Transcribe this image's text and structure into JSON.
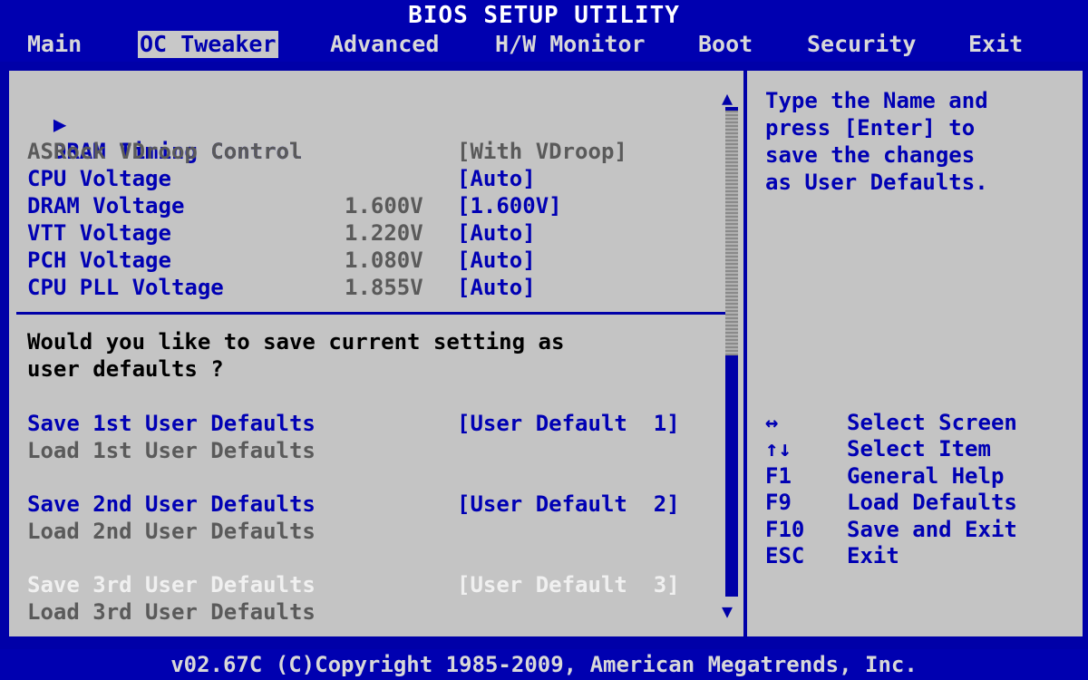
{
  "title": "BIOS SETUP UTILITY",
  "menu": [
    "Main",
    "OC Tweaker",
    "Advanced",
    "H/W Monitor",
    "Boot",
    "Security",
    "Exit"
  ],
  "submenu": {
    "arrow": "▶",
    "label": "DRAM Timing Control"
  },
  "settings": [
    {
      "label": "ASRock VDroop Control",
      "current": "",
      "value": "[With VDroop]"
    },
    {
      "label": "CPU Voltage",
      "current": "",
      "value": "[Auto]"
    },
    {
      "label": "DRAM Voltage",
      "current": "1.600V",
      "value": "[1.600V]"
    },
    {
      "label": "VTT Voltage",
      "current": "1.220V",
      "value": "[Auto]"
    },
    {
      "label": "PCH Voltage",
      "current": "1.080V",
      "value": "[Auto]"
    },
    {
      "label": "CPU PLL Voltage",
      "current": "1.855V",
      "value": "[Auto]"
    }
  ],
  "question": [
    "Would you like to save current setting as",
    "user defaults ?"
  ],
  "user_defaults": [
    {
      "label": "Save 1st User Defaults",
      "value": "[User Default  1]"
    },
    {
      "label": "Load 1st User Defaults",
      "value": ""
    },
    {
      "label": "Save 2nd User Defaults",
      "value": "[User Default  2]"
    },
    {
      "label": "Load 2nd User Defaults",
      "value": ""
    },
    {
      "label": "Save 3rd User Defaults",
      "value": "[User Default  3]"
    },
    {
      "label": "Load 3rd User Defaults",
      "value": ""
    }
  ],
  "help_text": [
    "Type the Name and",
    "press [Enter] to",
    "save the changes",
    "as User Defaults."
  ],
  "keys": [
    {
      "key": "↔",
      "action": "Select Screen"
    },
    {
      "key": "↑↓",
      "action": "Select Item"
    },
    {
      "key": "F1",
      "action": "General Help"
    },
    {
      "key": "F9",
      "action": "Load Defaults"
    },
    {
      "key": "F10",
      "action": "Save and Exit"
    },
    {
      "key": "ESC",
      "action": "Exit"
    }
  ],
  "scroll_arrows": {
    "up": "▲",
    "down": "▼"
  },
  "footer": "v02.67C (C)Copyright 1985-2009, American Megatrends, Inc."
}
